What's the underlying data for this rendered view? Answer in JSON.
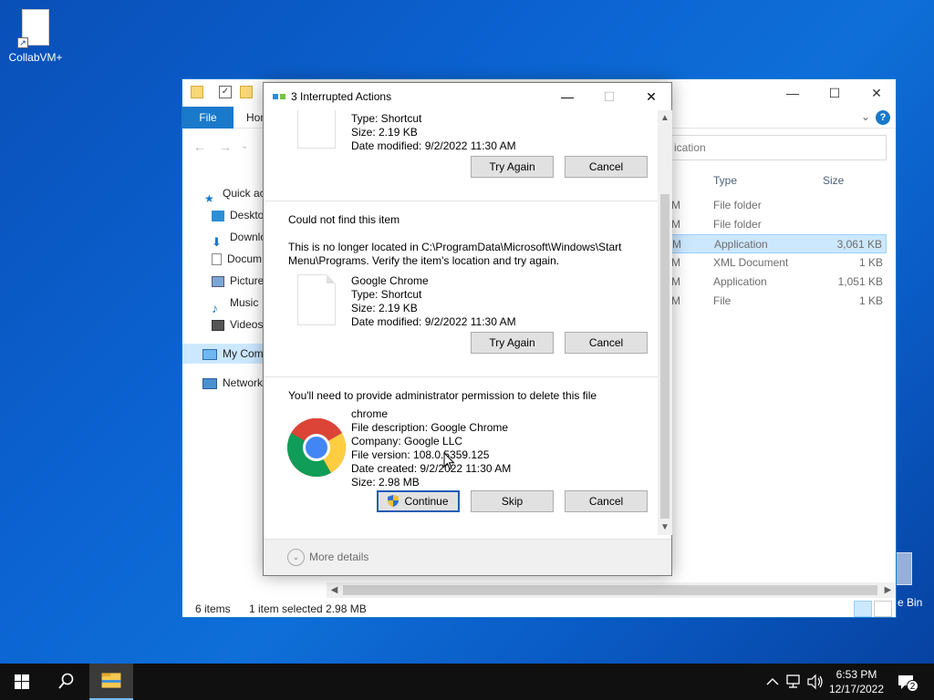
{
  "desktop": {
    "icons": [
      {
        "label": "CollabVM+"
      }
    ],
    "recycle_bin_label": "e Bin"
  },
  "explorer": {
    "ribbon": {
      "file_tab": "File",
      "home_tab": "Hon"
    },
    "search_placeholder": "ication",
    "nav": [
      {
        "label": "Quick ac",
        "icon": "star-icon"
      },
      {
        "label": "Deskto",
        "icon": "desktop-icon"
      },
      {
        "label": "Downlo",
        "icon": "download-icon"
      },
      {
        "label": "Docum",
        "icon": "document-icon"
      },
      {
        "label": "Picture",
        "icon": "pictures-icon"
      },
      {
        "label": "Music",
        "icon": "music-icon"
      },
      {
        "label": "Videos",
        "icon": "video-icon"
      },
      {
        "label": "My Com",
        "icon": "computer-icon"
      },
      {
        "label": "Network",
        "icon": "network-icon"
      }
    ],
    "columns": {
      "type": "Type",
      "size": "Size"
    },
    "files": [
      {
        "date_tail": "M",
        "type": "File folder",
        "size": ""
      },
      {
        "date_tail": "M",
        "type": "File folder",
        "size": ""
      },
      {
        "date_tail": "M",
        "type": "Application",
        "size": "3,061 KB",
        "selected": true
      },
      {
        "date_tail": "M",
        "type": "XML Document",
        "size": "1 KB"
      },
      {
        "date_tail": "M",
        "type": "Application",
        "size": "1,051 KB"
      },
      {
        "date_tail": "M",
        "type": "File",
        "size": "1 KB"
      }
    ],
    "status": {
      "items": "6 items",
      "selected": "1 item selected  2.98 MB"
    }
  },
  "dialog": {
    "title": "3 Interrupted Actions",
    "section1": {
      "type": "Type: Shortcut",
      "size": "Size: 2.19 KB",
      "modified": "Date modified: 9/2/2022 11:30 AM",
      "try_again": "Try Again",
      "cancel": "Cancel"
    },
    "section2": {
      "heading": "Could not find this item",
      "message_line1": "This is no longer located in C:\\ProgramData\\Microsoft\\Windows\\Start",
      "message_line2": "Menu\\Programs. Verify the item's location and try again.",
      "name": "Google Chrome",
      "type": "Type: Shortcut",
      "size": "Size: 2.19 KB",
      "modified": "Date modified: 9/2/2022 11:30 AM",
      "try_again": "Try Again",
      "cancel": "Cancel"
    },
    "section3": {
      "heading": "You'll need to provide administrator permission to delete this file",
      "name": "chrome",
      "description": "File description: Google Chrome",
      "company": "Company: Google LLC",
      "version": "File version: 108.0.5359.125",
      "created": "Date created: 9/2/2022 11:30 AM",
      "size": "Size: 2.98 MB",
      "continue": "Continue",
      "skip": "Skip",
      "cancel": "Cancel"
    },
    "more_details": "More details"
  },
  "taskbar": {
    "time": "6:53 PM",
    "date": "12/17/2022",
    "notification_count": "2"
  },
  "colors": {
    "accent": "#1979ca",
    "selection": "#cce8ff",
    "taskbar": "#101010"
  }
}
